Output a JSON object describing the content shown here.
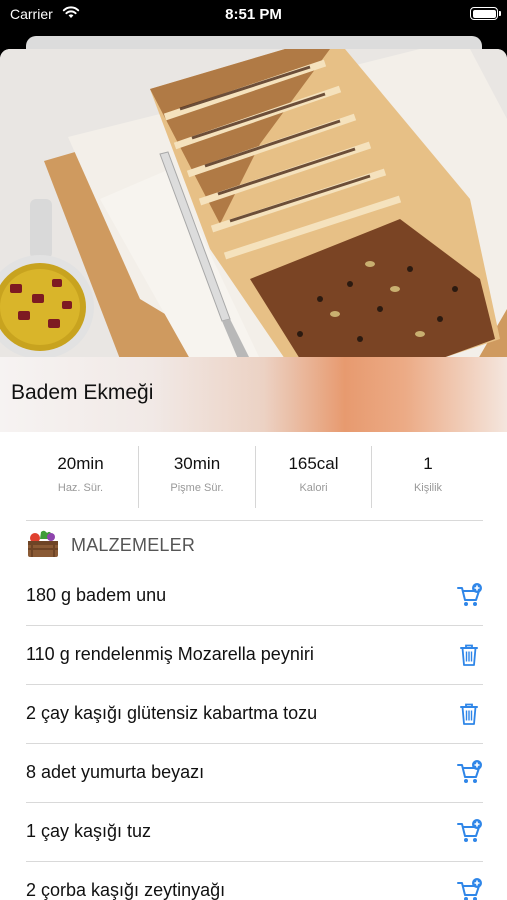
{
  "status_bar": {
    "carrier": "Carrier",
    "time": "8:51 PM"
  },
  "recipe": {
    "title": "Badem Ekmeği"
  },
  "stats": [
    {
      "value": "20min",
      "label": "Haz. Sür."
    },
    {
      "value": "30min",
      "label": "Pişme Sür."
    },
    {
      "value": "165cal",
      "label": "Kalori"
    },
    {
      "value": "1",
      "label": "Kişilik"
    }
  ],
  "ingredients_section": {
    "title": "MALZEMELER",
    "icon": "vegetable-crate-icon"
  },
  "ingredients": [
    {
      "text": "180 g badem unu",
      "action": "add-to-cart-icon"
    },
    {
      "text": "110 g rendelenmiş Mozarella peyniri",
      "action": "trash-icon"
    },
    {
      "text": "2 çay kaşığı glütensiz kabartma tozu",
      "action": "trash-icon"
    },
    {
      "text": "8 adet yumurta beyazı",
      "action": "add-to-cart-icon"
    },
    {
      "text": "1 çay kaşığı tuz",
      "action": "add-to-cart-icon"
    },
    {
      "text": "2 çorba kaşığı zeytinyağı",
      "action": "add-to-cart-icon"
    }
  ],
  "colors": {
    "accent": "#2f86e8",
    "background": "#ffffff",
    "divider": "#d9d9d9"
  }
}
